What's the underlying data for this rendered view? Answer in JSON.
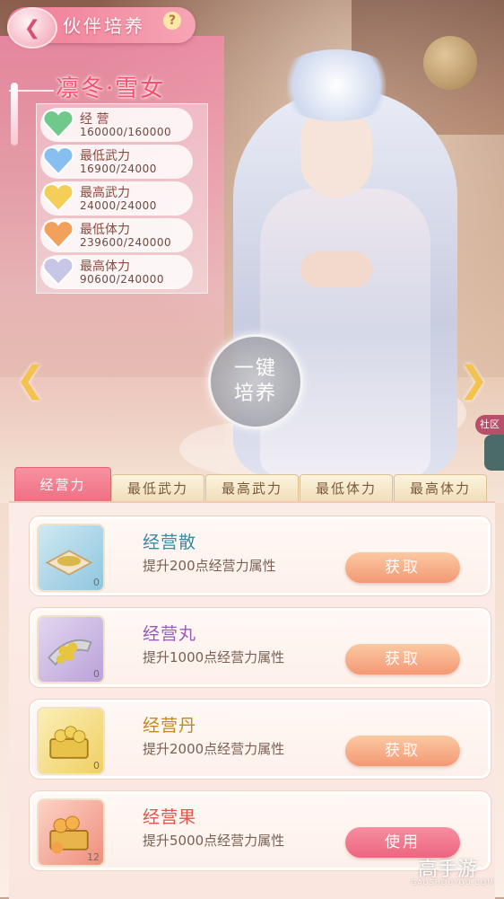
{
  "header": {
    "title": "伙伴培养",
    "help": "?",
    "back_icon": "back-arrow-icon"
  },
  "character": {
    "name": "凛冬·雪女"
  },
  "stats": [
    {
      "label": "经 营",
      "value": "160000/160000",
      "color": "#6ec98a"
    },
    {
      "label": "最低武力",
      "value": "16900/24000",
      "color": "#86bff0"
    },
    {
      "label": "最高武力",
      "value": "24000/24000",
      "color": "#f3cf5a"
    },
    {
      "label": "最低体力",
      "value": "239600/240000",
      "color": "#f2a15c"
    },
    {
      "label": "最高体力",
      "value": "90600/240000",
      "color": "#c7c6e6"
    }
  ],
  "train_button": {
    "line1": "一键",
    "line2": "培养"
  },
  "community_label": "社区",
  "tabs": [
    {
      "label": "经营力",
      "active": true
    },
    {
      "label": "最低武力",
      "active": false
    },
    {
      "label": "最高武力",
      "active": false
    },
    {
      "label": "最低体力",
      "active": false
    },
    {
      "label": "最高体力",
      "active": false
    }
  ],
  "items": [
    {
      "name": "经营散",
      "desc": "提升200点经营力属性",
      "count": "0",
      "button": "获取",
      "name_color": "#3a8aa4"
    },
    {
      "name": "经营丸",
      "desc": "提升1000点经营力属性",
      "count": "0",
      "button": "获取",
      "name_color": "#9a5ab8"
    },
    {
      "name": "经营丹",
      "desc": "提升2000点经营力属性",
      "count": "0",
      "button": "获取",
      "name_color": "#c4881e"
    },
    {
      "name": "经营果",
      "desc": "提升5000点经营力属性",
      "count": "12",
      "button": "使用",
      "name_color": "#e0554b"
    }
  ],
  "watermark": {
    "main": "高手游",
    "sub": "GAOSHOUYOU.COM"
  }
}
